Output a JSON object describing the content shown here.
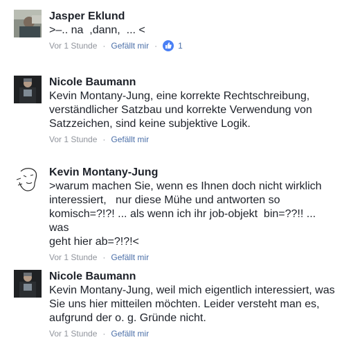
{
  "comments": [
    {
      "author": "Jasper Eklund",
      "text": ">–.. na  ,dann,  ... <",
      "time": "Vor 1 Stunde",
      "like_label": "Gefällt mir",
      "like_count": "1",
      "avatar_icon": "user-photo-avatar"
    },
    {
      "author": "Nicole Baumann",
      "text": "Kevin Montany-Jung, eine korrekte Rechtschreibung,\nverständlicher Satzbau und korrekte Verwendung von\nSatzzeichen, sind keine subjektive Logik.",
      "time": "Vor 1 Stunde",
      "like_label": "Gefällt mir",
      "avatar_icon": "user-photo-avatar"
    },
    {
      "author": "Kevin Montany-Jung",
      "text": ">warum machen Sie, wenn es Ihnen doch nicht wirklich\ninteressiert,   nur diese Mühe und antworten so\nkomisch=?!?! ... als wenn ich ihr job-objekt  bin=??!! ... was\ngeht hier ab=?!?!<",
      "time": "Vor 1 Stunde",
      "like_label": "Gefällt mir",
      "avatar_icon": "sketch-face-avatar"
    },
    {
      "author": "Nicole Baumann",
      "text": "Kevin Montany-Jung, weil mich eigentlich interessiert, was\nSie uns hier mitteilen möchten. Leider versteht man es,\naufgrund der o. g. Gründe nicht.",
      "time": "Vor 1 Stunde",
      "like_label": "Gefällt mir",
      "avatar_icon": "user-photo-avatar"
    }
  ],
  "colors": {
    "author": "#1d2129",
    "meta": "#90949c",
    "link": "#4b6fa8",
    "like_badge": "#4a80f5"
  }
}
